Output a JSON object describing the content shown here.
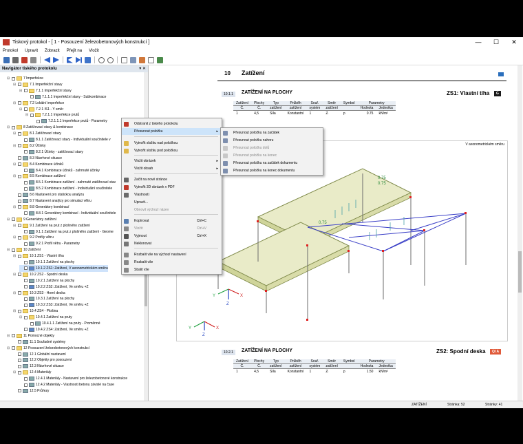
{
  "window": {
    "title": "Tiskový protokol - [ 1 - Posouzení železobetonových konstrukcí ]",
    "controls": [
      "—",
      "☐",
      "✕"
    ]
  },
  "menu": [
    "Protokol",
    "Upravit",
    "Zobrazit",
    "Přejít na",
    "Vložit"
  ],
  "navigator": {
    "title": "Navigátor tiského protokolu",
    "header_buttons": "▾ ✕",
    "items": [
      {
        "label": "7 Imperfekce",
        "level": 1,
        "kind": "folder",
        "exp": "⊟"
      },
      {
        "label": "7.1 Imperfekční stavy",
        "level": 2,
        "kind": "folder",
        "exp": "⊟"
      },
      {
        "label": "7.1.1 Imperfekční stavy",
        "level": 3,
        "kind": "folder",
        "exp": "⊟"
      },
      {
        "label": "7.1.1.1 Imperfekční stavy - Subkombinace",
        "level": 4,
        "kind": "doc",
        "exp": ""
      },
      {
        "label": "7.2 Lokální imperfekce",
        "level": 2,
        "kind": "folder",
        "exp": "⊟"
      },
      {
        "label": "7.2.1 IS1 - Y směr",
        "level": 3,
        "kind": "folder",
        "exp": "⊟"
      },
      {
        "label": "7.2.1.1 Imperfekce prutů",
        "level": 4,
        "kind": "folder",
        "exp": "⊟"
      },
      {
        "label": "7.2.1.1.1 Imperfekce prutů - Parametry",
        "level": 5,
        "kind": "doc",
        "exp": ""
      },
      {
        "label": "8 Zatěžovací stavy & kombinace",
        "level": 1,
        "kind": "folder",
        "exp": "⊟"
      },
      {
        "label": "8.1 Zatěžovací stavy",
        "level": 2,
        "kind": "folder",
        "exp": "⊟"
      },
      {
        "label": "8.1.1 Zatěžovací stavy - Individuální součinitele v",
        "level": 3,
        "kind": "doc",
        "exp": ""
      },
      {
        "label": "8.2 Účinky",
        "level": 2,
        "kind": "folder",
        "exp": "⊟"
      },
      {
        "label": "8.2.1 Účinky - zatěžovací stavy",
        "level": 3,
        "kind": "doc",
        "exp": ""
      },
      {
        "label": "8.3 Návrhové situace",
        "level": 2,
        "kind": "doc",
        "exp": ""
      },
      {
        "label": "8.4 Kombinace účinků",
        "level": 2,
        "kind": "folder",
        "exp": "⊟"
      },
      {
        "label": "8.4.1 Kombinace účinků - zahrnuté účinky",
        "level": 3,
        "kind": "doc",
        "exp": ""
      },
      {
        "label": "8.5 Kombinace zatížení",
        "level": 2,
        "kind": "folder",
        "exp": "⊟"
      },
      {
        "label": "8.5.1 Kombinace zatížení - zahrnuté zatěžovací stav",
        "level": 3,
        "kind": "doc",
        "exp": ""
      },
      {
        "label": "8.5.2 Kombinace zatížení - Individuální součinitele",
        "level": 3,
        "kind": "doc",
        "exp": ""
      },
      {
        "label": "8.6 Nastavení pro statickou analýzu",
        "level": 2,
        "kind": "doc",
        "exp": ""
      },
      {
        "label": "8.7 Nastavení analýzy pro simulaci větru",
        "level": 2,
        "kind": "doc",
        "exp": ""
      },
      {
        "label": "8.8 Generátory kombinací",
        "level": 2,
        "kind": "folder",
        "exp": "⊟"
      },
      {
        "label": "8.8.1 Generátory kombinací - Individuální součinitele",
        "level": 3,
        "kind": "doc",
        "exp": ""
      },
      {
        "label": "9 Generátory zatížení",
        "level": 1,
        "kind": "folder",
        "exp": "⊟"
      },
      {
        "label": "9.1 Zatížení na prut z plošného zatížení",
        "level": 2,
        "kind": "folder",
        "exp": "⊟"
      },
      {
        "label": "9.1.1 Zatížení na prut z plošného zatížení - Geome",
        "level": 3,
        "kind": "doc",
        "exp": ""
      },
      {
        "label": "9.2 Profily větru",
        "level": 2,
        "kind": "folder",
        "exp": "⊟"
      },
      {
        "label": "9.2.1 Profil větru - Parametry",
        "level": 3,
        "kind": "doc",
        "exp": ""
      },
      {
        "label": "10 Zatížení",
        "level": 1,
        "kind": "folder",
        "exp": "⊟"
      },
      {
        "label": "10.1 ZS1 - Vlastní tíha",
        "level": 2,
        "kind": "folder",
        "exp": "⊟"
      },
      {
        "label": "10.1.1 Zatížení na plochy",
        "level": 3,
        "kind": "doc",
        "exp": ""
      },
      {
        "label": "10.1.2 ZS1: Zatížení, V axonometrickém směru",
        "level": 3,
        "kind": "img",
        "exp": "",
        "selected": true
      },
      {
        "label": "10.2 ZS2 - Spodní deska",
        "level": 2,
        "kind": "folder",
        "exp": "⊟"
      },
      {
        "label": "10.2.1 Zatížení na plochy",
        "level": 3,
        "kind": "doc",
        "exp": ""
      },
      {
        "label": "10.2.2 ZS2: Zatížení, Ve směru +Z",
        "level": 3,
        "kind": "img",
        "exp": ""
      },
      {
        "label": "10.3 ZS3 - Horní deska",
        "level": 2,
        "kind": "folder",
        "exp": "⊟"
      },
      {
        "label": "10.3.1 Zatížení na plochy",
        "level": 3,
        "kind": "doc",
        "exp": ""
      },
      {
        "label": "10.3.2 ZS3: Zatížení, Ve směru +Z",
        "level": 3,
        "kind": "img",
        "exp": ""
      },
      {
        "label": "10.4 ZS4 - Plošina",
        "level": 2,
        "kind": "folder",
        "exp": "⊟"
      },
      {
        "label": "10.4.1 Zatížení na pruty",
        "level": 3,
        "kind": "folder",
        "exp": "⊟"
      },
      {
        "label": "10.4.1.1 Zatížení na pruty - Proměnné",
        "level": 4,
        "kind": "doc",
        "exp": ""
      },
      {
        "label": "10.4.2 ZS4: Zatížení, Ve směru +Z",
        "level": 3,
        "kind": "img",
        "exp": ""
      },
      {
        "label": "11 Pomocné objekty",
        "level": 1,
        "kind": "folder",
        "exp": "⊟"
      },
      {
        "label": "11.1 Souřadné systémy",
        "level": 2,
        "kind": "doc",
        "exp": ""
      },
      {
        "label": "12 Posouzení železobetonových konstrukcí",
        "level": 1,
        "kind": "folder",
        "exp": "⊟"
      },
      {
        "label": "12.1 Globální nastavení",
        "level": 2,
        "kind": "doc",
        "exp": ""
      },
      {
        "label": "12.2 Objekty pro posouzení",
        "level": 2,
        "kind": "doc",
        "exp": ""
      },
      {
        "label": "12.3 Návrhové situace",
        "level": 2,
        "kind": "doc",
        "exp": ""
      },
      {
        "label": "12.4 Materiály",
        "level": 2,
        "kind": "folder",
        "exp": "⊟"
      },
      {
        "label": "12.4.1 Materiály - Nastavení pro železobetonové konstrukce",
        "level": 3,
        "kind": "doc",
        "exp": ""
      },
      {
        "label": "12.4.2 Materiály - Vlastnosti betonu závislé na čase",
        "level": 3,
        "kind": "doc",
        "exp": ""
      },
      {
        "label": "12.5 Průřezy",
        "level": 2,
        "kind": "doc",
        "exp": ""
      }
    ]
  },
  "document": {
    "chapter_number": "10",
    "chapter_title": "Zatížení",
    "section1": {
      "number": "10.1.1",
      "title": "ZATÍŽENÍ NA PLOCHY",
      "lc_name": "ZS1: Vlastní tíha",
      "lc_badge": "G",
      "lc_badge_color": "#1a1a1a"
    },
    "section2": {
      "number": "10.2.1",
      "title": "ZATÍŽENÍ NA PLOCHY",
      "lc_name": "ZS2: Spodní deska",
      "lc_badge": "QI A",
      "lc_badge_color": "#e05a3a"
    },
    "table_head1": [
      "Zatížení",
      "Plochy",
      "Typ",
      "Průběh",
      "Souř.",
      "Směr",
      "Symbol",
      "Parametry",
      ""
    ],
    "table_head2": [
      "Č.",
      "Č.",
      "zatížení",
      "zatížení",
      "systém",
      "zatížení",
      "",
      "Hodnota",
      "Jednotka"
    ],
    "row1": [
      "1",
      "4,5",
      "Síla",
      "Konstantní",
      "1",
      "Zₗ",
      "p",
      "0.75",
      "kN/m²"
    ],
    "row2": [
      "1",
      "4,5",
      "Síla",
      "Konstantní",
      "1",
      "Zₗ",
      "p",
      "1.50",
      "kN/m²"
    ],
    "graphic": {
      "label": "V axonometrickém směru",
      "value_a": "0.75",
      "value_b": "0.75",
      "value_c": "0.75",
      "axis_x": "X",
      "axis_y": "Y",
      "axis_z": "Z"
    }
  },
  "context_menu": {
    "items": [
      {
        "label": "Odstranit z tiského protokolu",
        "icon": "delete-icon",
        "shortcut": "",
        "arrow": false,
        "disabled": false,
        "highlight": false
      },
      {
        "label": "Přesunout položku",
        "icon": "",
        "shortcut": "",
        "arrow": true,
        "disabled": false,
        "highlight": true
      },
      {
        "label": "Vytvořit složku nad položkou",
        "icon": "folder-icon",
        "shortcut": "",
        "arrow": false,
        "disabled": false,
        "highlight": false
      },
      {
        "label": "Vytvořit složku pod položkou",
        "icon": "folder-icon",
        "shortcut": "",
        "arrow": false,
        "disabled": false,
        "highlight": false
      },
      {
        "label": "Vložit obrázek",
        "icon": "",
        "shortcut": "",
        "arrow": true,
        "disabled": false,
        "highlight": false
      },
      {
        "label": "Vložit obsah",
        "icon": "",
        "shortcut": "",
        "arrow": true,
        "disabled": false,
        "highlight": false
      },
      {
        "label": "Začít na nové stránce",
        "icon": "page-icon",
        "shortcut": "",
        "arrow": false,
        "disabled": false,
        "highlight": false
      },
      {
        "label": "Vytvořit 3D obrázek v PDF",
        "icon": "pdf-icon",
        "shortcut": "",
        "arrow": false,
        "disabled": false,
        "highlight": false
      },
      {
        "label": "Vlastnosti",
        "icon": "properties-icon",
        "shortcut": "",
        "arrow": false,
        "disabled": false,
        "highlight": false
      },
      {
        "label": "Upravit...",
        "icon": "",
        "shortcut": "",
        "arrow": false,
        "disabled": false,
        "highlight": false
      },
      {
        "label": "Obnovit výchozí název",
        "icon": "",
        "shortcut": "",
        "arrow": false,
        "disabled": true,
        "highlight": false
      },
      {
        "label": "Kopírovat",
        "icon": "copy-icon",
        "shortcut": "Ctrl+C",
        "arrow": false,
        "disabled": false,
        "highlight": false
      },
      {
        "label": "Vložit",
        "icon": "paste-icon",
        "shortcut": "Ctrl+V",
        "arrow": false,
        "disabled": true,
        "highlight": false
      },
      {
        "label": "Vyjmout",
        "icon": "cut-icon",
        "shortcut": "Ctrl+X",
        "arrow": false,
        "disabled": false,
        "highlight": false
      },
      {
        "label": "Neklonovat",
        "icon": "clone-icon",
        "shortcut": "",
        "arrow": false,
        "disabled": false,
        "highlight": false
      },
      {
        "label": "Rozbalit vše na výchozí nastavení",
        "icon": "expand-icon",
        "shortcut": "",
        "arrow": false,
        "disabled": false,
        "highlight": false
      },
      {
        "label": "Rozbalit vše",
        "icon": "expand-icon",
        "shortcut": "",
        "arrow": false,
        "disabled": false,
        "highlight": false
      },
      {
        "label": "Sbalit vše",
        "icon": "collapse-icon",
        "shortcut": "",
        "arrow": false,
        "disabled": false,
        "highlight": false
      }
    ]
  },
  "submenu": {
    "items": [
      {
        "label": "Přesunout položku na začátek",
        "disabled": false
      },
      {
        "label": "Přesunout položku nahoru",
        "disabled": false
      },
      {
        "label": "Přesunout položku dolů",
        "disabled": true
      },
      {
        "label": "Přesunout položku na konec",
        "disabled": true
      },
      {
        "label": "Přesunout položku na začátek dokumentu",
        "disabled": false
      },
      {
        "label": "Přesunout položku na konec dokumentu",
        "disabled": false
      }
    ]
  },
  "status": {
    "left": "ZATÍŽENÍ",
    "page": "Stránka: 52",
    "pages": "Stránky: 41"
  }
}
